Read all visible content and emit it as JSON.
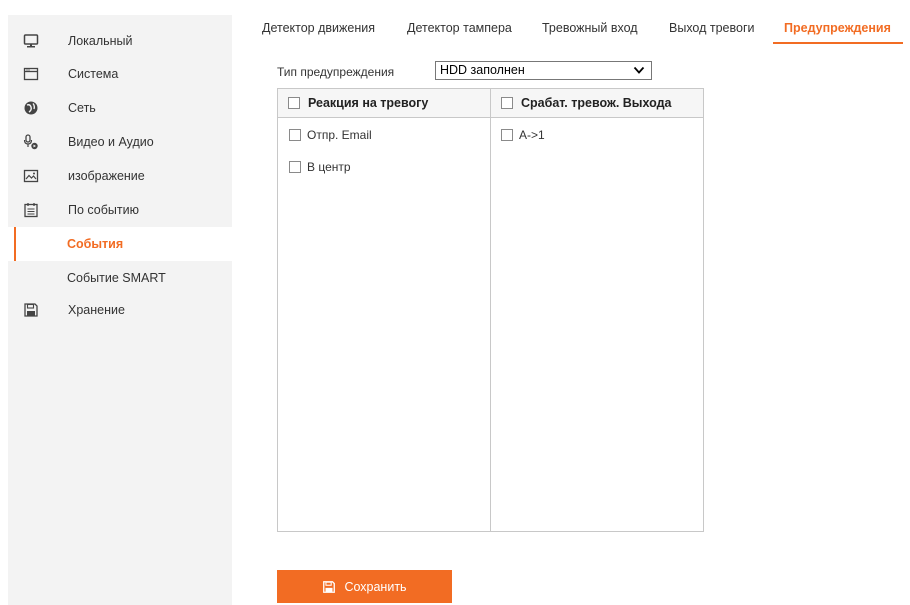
{
  "sidebar": {
    "items": [
      {
        "label": "Локальный",
        "icon": "monitor-icon"
      },
      {
        "label": "Система",
        "icon": "system-icon"
      },
      {
        "label": "Сеть",
        "icon": "globe-icon"
      },
      {
        "label": "Видео и Аудио",
        "icon": "microphone-icon"
      },
      {
        "label": "изображение",
        "icon": "image-icon"
      },
      {
        "label": "По событию",
        "icon": "calendar-icon"
      },
      {
        "label": "События",
        "active": true
      },
      {
        "label": "Событие SMART"
      },
      {
        "label": "Хранение",
        "icon": "floppy-disk-icon"
      }
    ]
  },
  "tabs": [
    {
      "label": "Детектор движения"
    },
    {
      "label": "Детектор тампера"
    },
    {
      "label": "Тревожный вход"
    },
    {
      "label": "Выход тревоги"
    },
    {
      "label": "Предупреждения",
      "active": true
    }
  ],
  "warning_type": {
    "label": "Тип предупреждения",
    "selected": "HDD заполнен"
  },
  "panels": {
    "left": {
      "header": "Реакция на тревогу",
      "options": [
        "Отпр. Email",
        "В центр"
      ]
    },
    "right": {
      "header": "Срабат. тревож. Выхода",
      "options": [
        "A->1"
      ]
    }
  },
  "save_button": {
    "label": "Сохранить"
  },
  "colors": {
    "accent": "#f26c23",
    "sidebar_bg": "#f3f3f3",
    "border": "#c8c8c8"
  }
}
